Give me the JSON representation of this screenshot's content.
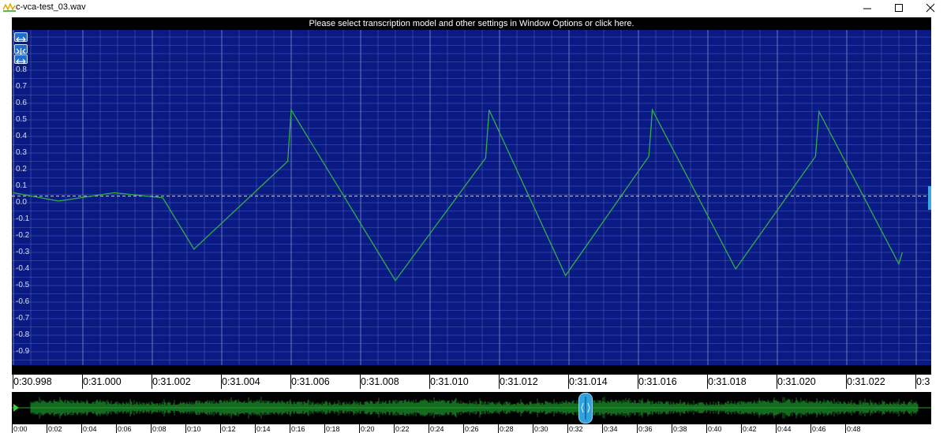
{
  "window": {
    "title": "c-vca-test_03.wav",
    "app_icon": "waveform-app-icon",
    "controls": {
      "minimize": "minimize-icon",
      "maximize": "maximize-icon",
      "close": "close-icon"
    }
  },
  "notice": "Please select transcription model and other settings in Window Options or click here.",
  "colors": {
    "wave_background": "#0a1a85",
    "grid_line": "#8f98cf",
    "waveform": "#2fb04a",
    "zero_line": "#c9d0ee",
    "overview_wave": "#1f9e2f",
    "handle": "#2fa2e0"
  },
  "zoom_buttons": [
    {
      "name": "zoom-fit-icon"
    },
    {
      "name": "zoom-out-icon"
    },
    {
      "name": "zoom-in-icon"
    }
  ],
  "amplitude_axis": {
    "ticks": [
      "0.8",
      "0.7",
      "0.6",
      "0.5",
      "0.4",
      "0.3",
      "0.2",
      "0.1",
      "0.0",
      "-0.1",
      "-0.2",
      "-0.3",
      "-0.4",
      "-0.5",
      "-0.6",
      "-0.7",
      "-0.8",
      "-0.9"
    ],
    "values": [
      0.8,
      0.7,
      0.6,
      0.5,
      0.4,
      0.3,
      0.2,
      0.1,
      0.0,
      -0.1,
      -0.2,
      -0.3,
      -0.4,
      -0.5,
      -0.6,
      -0.7,
      -0.8,
      -0.9
    ]
  },
  "time_ruler": {
    "labels": [
      "0:30.998",
      "0:31.000",
      "0:31.002",
      "0:31.004",
      "0:31.006",
      "0:31.008",
      "0:31.010",
      "0:31.012",
      "0:31.014",
      "0:31.016",
      "0:31.018",
      "0:31.020",
      "0:31.022",
      "0:3"
    ],
    "start_seconds": 30.998,
    "step_seconds": 0.002
  },
  "waveform": {
    "points": [
      [
        30.998,
        0.06
      ],
      [
        30.9993,
        0.01
      ],
      [
        31.0009,
        0.06
      ],
      [
        31.0023,
        0.03
      ],
      [
        31.0032,
        -0.28
      ],
      [
        31.0059,
        0.25
      ],
      [
        31.006,
        0.56
      ],
      [
        31.009,
        -0.47
      ],
      [
        31.0116,
        0.27
      ],
      [
        31.0117,
        0.56
      ],
      [
        31.0139,
        -0.44
      ],
      [
        31.0163,
        0.28
      ],
      [
        31.0164,
        0.56
      ],
      [
        31.0188,
        -0.4
      ],
      [
        31.0211,
        0.28
      ],
      [
        31.0212,
        0.55
      ],
      [
        31.0235,
        -0.37
      ],
      [
        31.0236,
        -0.3
      ]
    ]
  },
  "overview": {
    "labels": [
      "0:00",
      "0:02",
      "0:04",
      "0:06",
      "0:08",
      "0:10",
      "0:12",
      "0:14",
      "0:16",
      "0:18",
      "0:20",
      "0:22",
      "0:24",
      "0:26",
      "0:28",
      "0:30",
      "0:32",
      "0:34",
      "0:36",
      "0:38",
      "0:40",
      "0:42",
      "0:44",
      "0:46",
      "0:48"
    ],
    "position_seconds": 31.0
  }
}
